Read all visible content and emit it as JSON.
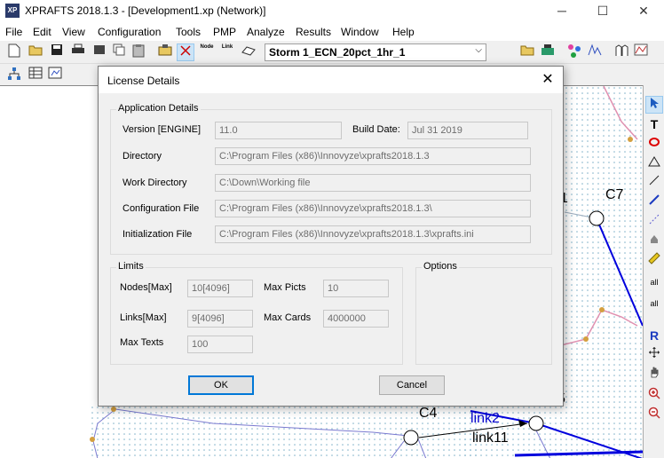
{
  "window": {
    "title": "XPRAFTS 2018.1.3 - [Development1.xp (Network)]",
    "icon_text": "XP",
    "minimize": "─",
    "maximize": "☐",
    "close": "✕"
  },
  "menu": [
    "File",
    "Edit",
    "View",
    "Configuration",
    "Tools",
    "PMP",
    "Analyze",
    "Results",
    "Window",
    "Help"
  ],
  "toolbar": {
    "node_label": "Node",
    "link_label": "Link",
    "scenario_value": "Storm 1_ECN_20pct_1hr_1",
    "scenario_arrow": "⌵"
  },
  "canvas": {
    "labels": [
      "C7",
      "C4",
      "link2",
      "link11",
      "1",
      "5"
    ]
  },
  "right_tools": {
    "text_tool": "T",
    "all_label_1": "all",
    "all_label_2": "all",
    "refresh_label": "R"
  },
  "dialog": {
    "title": "License Details",
    "close": "✕",
    "app_details": {
      "group_label": "Application Details",
      "version_label": "Version [ENGINE]",
      "version_value": "11.0",
      "build_date_label": "Build Date:",
      "build_date_value": "Jul 31 2019",
      "directory_label": "Directory",
      "directory_value": "C:\\Program Files (x86)\\Innovyze\\xprafts2018.1.3",
      "work_directory_label": "Work Directory",
      "work_directory_value": "C:\\Down\\Working file",
      "config_file_label": "Configuration File",
      "config_file_value": "C:\\Program Files (x86)\\Innovyze\\xprafts2018.1.3\\",
      "init_file_label": "Initialization File",
      "init_file_value": "C:\\Program Files (x86)\\Innovyze\\xprafts2018.1.3\\xprafts.ini"
    },
    "limits": {
      "group_label": "Limits",
      "nodes_label": "Nodes[Max]",
      "nodes_value": "10[4096]",
      "max_picts_label": "Max Picts",
      "max_picts_value": "10",
      "links_label": "Links[Max]",
      "links_value": "9[4096]",
      "max_cards_label": "Max Cards",
      "max_cards_value": "4000000",
      "max_texts_label": "Max Texts",
      "max_texts_value": "100"
    },
    "options": {
      "group_label": "Options"
    },
    "ok_label": "OK",
    "cancel_label": "Cancel"
  }
}
